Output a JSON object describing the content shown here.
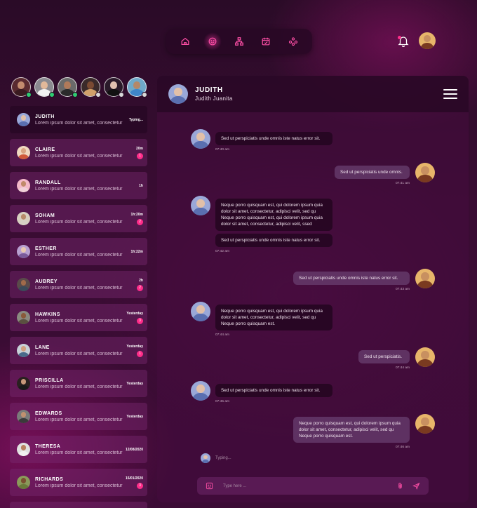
{
  "nav": {
    "items": [
      {
        "icon": "home-icon",
        "active": false
      },
      {
        "icon": "chat-icon",
        "active": true
      },
      {
        "icon": "network-icon",
        "active": false
      },
      {
        "icon": "calendar-icon",
        "active": false
      },
      {
        "icon": "group-icon",
        "active": false
      }
    ],
    "accent": "#ff2d8a"
  },
  "stories": [
    {
      "status": "#2ecc71",
      "skin": "#c38b6e",
      "shirt": "#3a1a20"
    },
    {
      "status": "#2ecc71",
      "skin": "#e2b99a",
      "shirt": "#f2f2f2"
    },
    {
      "status": "#2ecc71",
      "skin": "#b07a5a",
      "shirt": "#2b2b2b"
    },
    {
      "status": "#d9d9d9",
      "skin": "#7a4a32",
      "shirt": "#d0a06a"
    },
    {
      "status": "#d9d9d9",
      "skin": "#e0c0b0",
      "shirt": "#111111"
    },
    {
      "status": "#d9d9d9",
      "skin": "#b58868",
      "shirt": "#3f86c9"
    }
  ],
  "contacts": [
    {
      "name": "JUDITH",
      "msg": "Lorem ipsum dolor sit amet, consectetur",
      "time": "",
      "typing": "Typing...",
      "badge": "",
      "active": true,
      "skin": "#e2c0a8",
      "shirt": "#5a6fb0"
    },
    {
      "name": "CLAIRE",
      "msg": "Lorem ipsum dolor sit amet, consectetur",
      "time": "20m",
      "badge": "1",
      "skin": "#d9a582",
      "shirt": "#d05a3a"
    },
    {
      "name": "RANDALL",
      "msg": "Lorem ipsum dolor sit amet, consectetur",
      "time": "1h",
      "badge": "",
      "skin": "#c08a6a",
      "shirt": "#f0d0d8"
    },
    {
      "name": "SOHAM",
      "msg": "Lorem ipsum dolor sit amet, consectetur",
      "time": "1h:20m",
      "badge": "2",
      "skin": "#b88a6a",
      "shirt": "#d6d0c4"
    },
    {
      "name": "ESTHER",
      "msg": "Lorem ipsum dolor sit amet, consectetur",
      "time": "1h:22m",
      "badge": "",
      "skin": "#e8c8b0",
      "shirt": "#7a5a9a"
    },
    {
      "name": "AUBREY",
      "msg": "Lorem ipsum dolor sit amet, consectetur",
      "time": "2h",
      "badge": "2",
      "skin": "#a06a4a",
      "shirt": "#3a4a5a"
    },
    {
      "name": "HAWKINS",
      "msg": "Lorem ipsum dolor sit amet, consectetur",
      "time": "Yesterday",
      "badge": "3",
      "skin": "#8a5a3a",
      "shirt": "#5a5040"
    },
    {
      "name": "LANE",
      "msg": "Lorem ipsum dolor sit amet, consectetur",
      "time": "Yesterday",
      "badge": "1",
      "skin": "#d0a080",
      "shirt": "#4a6a8a"
    },
    {
      "name": "PRISCILLA",
      "msg": "Lorem ipsum dolor sit amet, consectetur",
      "time": "Yesterday",
      "badge": "",
      "skin": "#c8987a",
      "shirt": "#1a1a1a"
    },
    {
      "name": "EDWARDS",
      "msg": "Lorem ipsum dolor sit amet, consectetur",
      "time": "Yesterday",
      "badge": "",
      "skin": "#c09070",
      "shirt": "#3a3a3a"
    },
    {
      "name": "THERESA",
      "msg": "Lorem ipsum dolor sit amet, consectetur",
      "time": "12/08/2020",
      "badge": "",
      "skin": "#b88060",
      "shirt": "#f0f0f0"
    },
    {
      "name": "RICHARDS",
      "msg": "Lorem ipsum dolor sit amet, consectetur",
      "time": "15/01/2020",
      "badge": "3",
      "skin": "#7a5030",
      "shirt": "#6a7a3a"
    }
  ],
  "chat": {
    "name": "JUDITH",
    "fullname": "Judith Juanita",
    "typing": "Typing...",
    "placeholder": "Type here ...",
    "messages": [
      {
        "dir": "in",
        "text": "Sed ut perspiciatis unde omnis iste natus error sit.",
        "time": "07:40 am"
      },
      {
        "dir": "out",
        "text": "Sed ut perspiciatis unde omnis.",
        "time": "07:41 am"
      },
      {
        "dir": "in",
        "text": "Neque porro quisquam est, qui dolorem ipsum quia dolor sit amet, consectetur, adipisci velit, sed qu Neque porro quisquam est, qui dolorem ipsum quia dolor sit amet, consectetur, adipisci velit, ssed",
        "time": ""
      },
      {
        "dir": "in",
        "text": "Sed ut perspiciatis unde omnis iste natus error sit.",
        "time": "07:42 am"
      },
      {
        "dir": "out",
        "text": "Sed ut perspiciatis unde omnis iste natus error sit.",
        "time": "07:43 am"
      },
      {
        "dir": "in",
        "text": "Neque porro quisquam est, qui dolorem ipsum quia dolor sit amet, consectetur, adipisci velit, sed qu Neque porro quisquam est.",
        "time": "07:44 am"
      },
      {
        "dir": "out",
        "text": "Sed ut perspiciatis.",
        "time": "07:44 am"
      },
      {
        "dir": "in",
        "text": "Sed ut perspiciatis unde omnis iste natus error sit.",
        "time": "07:45 am"
      },
      {
        "dir": "out",
        "text": "Neque porro quisquam est, qui dolorem ipsum quia dolor sit amet, consectetur, adipisci velit, sed qu Neque porro quisquam est.",
        "time": "07:46 am"
      }
    ]
  }
}
